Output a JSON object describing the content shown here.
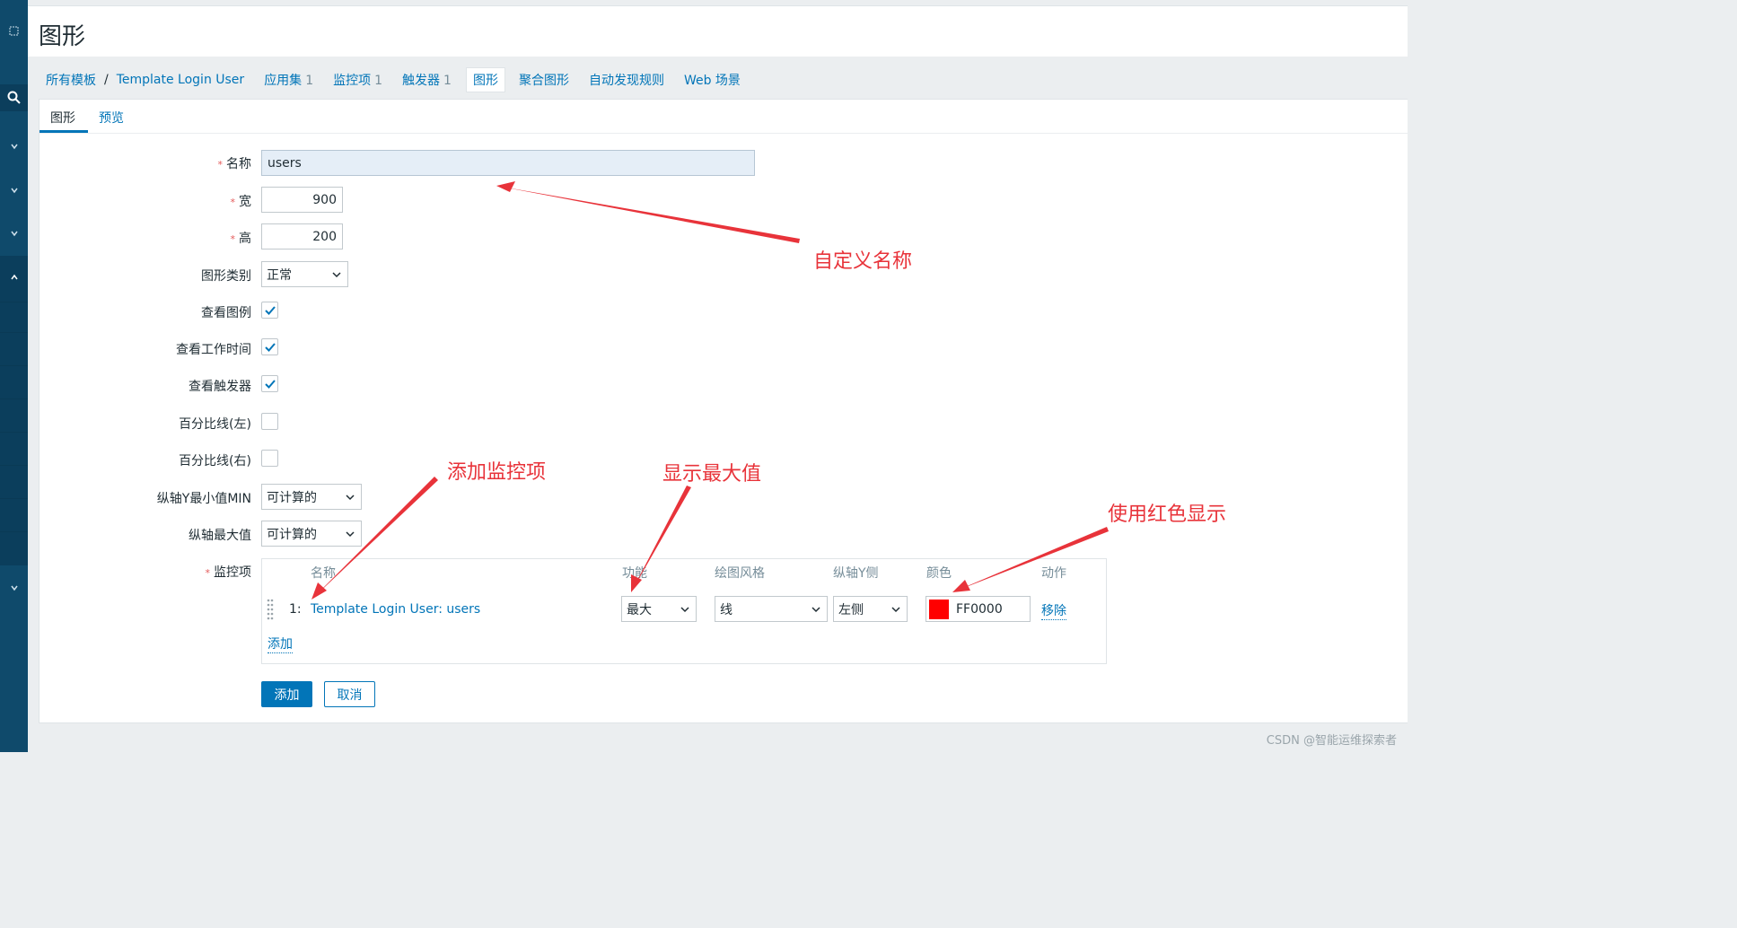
{
  "page": {
    "title": "图形"
  },
  "breadcrumb": {
    "all_templates": "所有模板",
    "separator": "/",
    "template_name": "Template Login User",
    "tabs": [
      {
        "label": "应用集",
        "count": "1"
      },
      {
        "label": "监控项",
        "count": "1"
      },
      {
        "label": "触发器",
        "count": "1"
      },
      {
        "label": "图形",
        "count": ""
      },
      {
        "label": "聚合图形",
        "count": ""
      },
      {
        "label": "自动发现规则",
        "count": ""
      },
      {
        "label": "Web 场景",
        "count": ""
      }
    ]
  },
  "subtabs": {
    "graph": "图形",
    "preview": "预览"
  },
  "form": {
    "required_mark": "*",
    "name_label": "名称",
    "name_value": "users",
    "width_label": "宽",
    "width_value": "900",
    "height_label": "高",
    "height_value": "200",
    "graph_type_label": "图形类别",
    "graph_type_value": "正常",
    "show_legend_label": "查看图例",
    "show_legend_checked": true,
    "show_working_time_label": "查看工作时间",
    "show_working_time_checked": true,
    "show_triggers_label": "查看触发器",
    "show_triggers_checked": true,
    "percentile_left_label": "百分比线(左)",
    "percentile_left_checked": false,
    "percentile_right_label": "百分比线(右)",
    "percentile_right_checked": false,
    "ymin_label": "纵轴Y最小值MIN",
    "ymin_value": "可计算的",
    "ymax_label": "纵轴最大值",
    "ymax_value": "可计算的",
    "items_label": "监控项"
  },
  "items_table": {
    "headers": {
      "name": "名称",
      "function": "功能",
      "draw_style": "绘图风格",
      "y_axis_side": "纵轴Y侧",
      "color": "颜色",
      "action": "动作"
    },
    "rows": [
      {
        "index": "1:",
        "name": "Template Login User: users",
        "function": "最大",
        "draw_style": "线",
        "y_axis_side": "左侧",
        "color_hex": "#FF0000",
        "color_value": "FF0000",
        "action": "移除"
      }
    ],
    "add_link": "添加"
  },
  "buttons": {
    "add": "添加",
    "cancel": "取消"
  },
  "annotations": {
    "custom_name": "自定义名称",
    "add_item": "添加监控项",
    "show_max": "显示最大值",
    "use_red": "使用红色显示"
  },
  "watermark": "CSDN @智能运维探索者",
  "colors": {
    "accent": "#0275b8",
    "annotation": "#e8333a",
    "nav": "#0f4a6b"
  }
}
